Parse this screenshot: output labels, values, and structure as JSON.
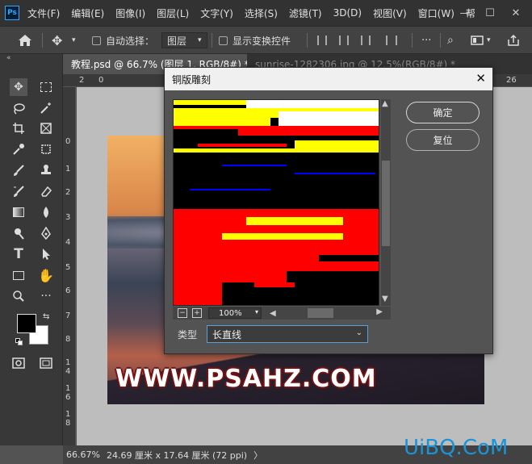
{
  "app": {
    "logo": "Ps"
  },
  "menubar": {
    "items": [
      "文件(F)",
      "编辑(E)",
      "图像(I)",
      "图层(L)",
      "文字(Y)",
      "选择(S)",
      "滤镜(T)",
      "3D(D)",
      "视图(V)",
      "窗口(W)",
      "帮"
    ],
    "window_controls": [
      "—",
      "☐",
      "✕"
    ]
  },
  "optionsbar": {
    "auto_select_label": "自动选择：",
    "layer_select_value": "图层",
    "show_transform_label": "显示变换控件"
  },
  "tabs": [
    {
      "label": "教程.psd @ 66.7% (图层 1, RGB/8#) *"
    },
    {
      "label": "sunrise-1282306.jpg @ 12.5%(RGB/8#) *"
    }
  ],
  "rulers": {
    "horizontal": [
      "2",
      "0",
      "26"
    ],
    "vertical": [
      "0",
      "1",
      "2",
      "3",
      "4",
      "5",
      "6",
      "7",
      "8",
      "1\n0",
      "1\n2",
      "1\n4",
      "1\n6",
      "1\n8"
    ]
  },
  "status": {
    "zoom": "66.67%",
    "doc_info": "24.69 厘米 x 17.64 厘米 (72 ppi)",
    "arrow": "〉"
  },
  "watermark": "WWW.PSAHZ.COM",
  "brand": "UiBQ.CoM",
  "dialog": {
    "title": "铜版雕刻",
    "ok_label": "确定",
    "reset_label": "复位",
    "zoom_value": "100%",
    "type_label": "类型",
    "type_value": "长直线",
    "preview_colors": {
      "black": "#000000",
      "red": "#ff0000",
      "yellow": "#ffff00",
      "white": "#ffffff",
      "blue": "#0000ff"
    }
  },
  "icons": [
    "home-icon",
    "move-icon",
    "marquee-icon",
    "lasso-icon",
    "crop-icon",
    "eyedropper-icon",
    "brush-icon",
    "stamp-icon",
    "eraser-icon",
    "gradient-icon",
    "blur-icon",
    "dodge-icon",
    "pen-icon",
    "text-icon",
    "path-select-icon",
    "rectangle-icon",
    "hand-icon",
    "zoom-icon",
    "more-icon",
    "search-icon"
  ]
}
